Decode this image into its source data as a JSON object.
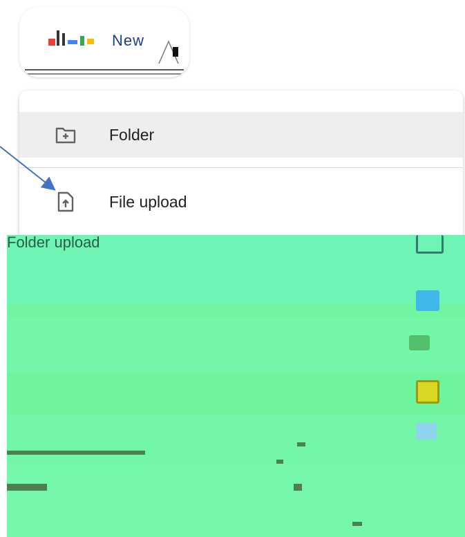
{
  "new_button": {
    "label": "New"
  },
  "menu": {
    "items": [
      {
        "label": "Folder",
        "icon": "new-folder-icon"
      },
      {
        "label": "File upload",
        "icon": "file-upload-icon"
      },
      {
        "label": "Folder upload",
        "icon": "folder-upload-icon"
      }
    ]
  },
  "colors": {
    "arrow": "#4472c4",
    "highlight": "#eeeeee",
    "glitch_green": "#72f7a8",
    "icon_gray": "#5f6368"
  }
}
